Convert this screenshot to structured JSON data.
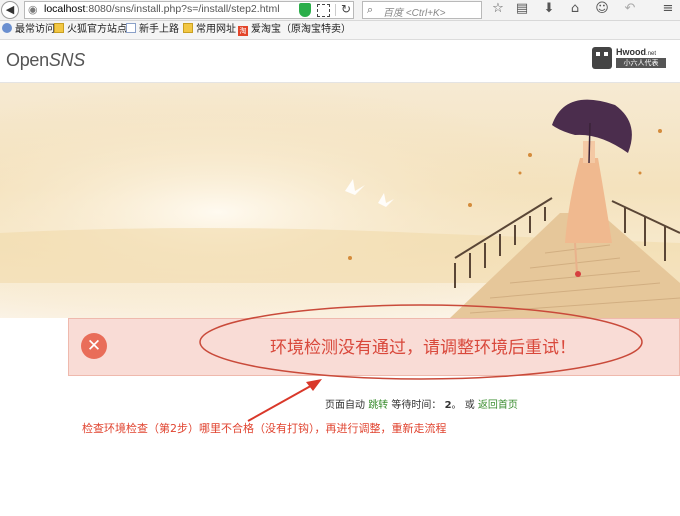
{
  "browser": {
    "url_host": "localhost",
    "url_rest": ":8080/sns/install.php?s=/install/step2.html",
    "search_placeholder": "百度 <Ctrl+K>",
    "icons": [
      "back-icon",
      "globe-icon",
      "shield-icon",
      "qrcode-icon",
      "reload-icon",
      "search-icon",
      "star-icon",
      "clipboard-icon",
      "download-icon",
      "home-icon",
      "smiley-icon",
      "undo-icon",
      "menu-icon"
    ]
  },
  "bookmarks": [
    {
      "label": "最常访问",
      "icon": "gear-icon"
    },
    {
      "label": "火狐官方站点",
      "icon": "folder-icon"
    },
    {
      "label": "新手上路",
      "icon": "page-icon"
    },
    {
      "label": "常用网址",
      "icon": "folder-icon"
    },
    {
      "label": "爱淘宝（原淘宝特卖）",
      "icon": "taobao-icon"
    }
  ],
  "site": {
    "logo_open": "Open",
    "logo_sns": "SNS",
    "badge_brand": "Hwood",
    "badge_brand_suffix": ".net",
    "badge_tag": "小六人代表"
  },
  "error": {
    "icon": "close-icon",
    "message": "环境检测没有通过，请调整环境后重试！",
    "color": "#d9483b"
  },
  "redirect": {
    "prefix": "页面自动",
    "jump_link": "跳转",
    "wait_label": "等待时间：",
    "seconds": "2",
    "suffix": "。 或",
    "home_link": "返回首页"
  },
  "annotation": {
    "text": "检查环境检查（第2步）哪里不合格（没有打钩），再进行调整，重新走流程",
    "color": "#e0432f"
  }
}
